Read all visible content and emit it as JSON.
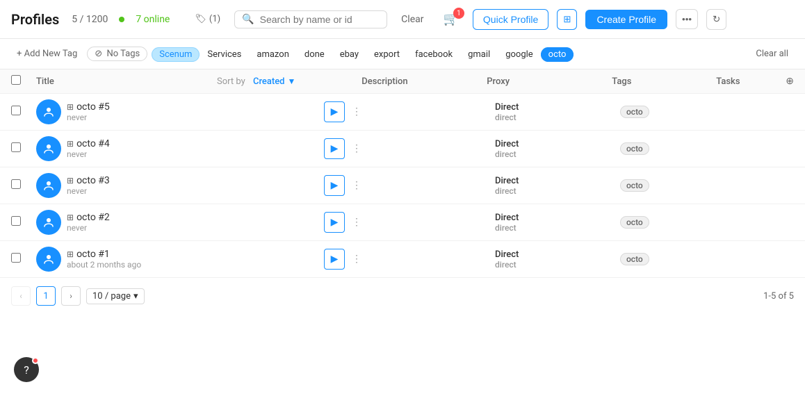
{
  "header": {
    "title": "Profiles",
    "count": "5 / 1200",
    "online_count": "7 online",
    "tag_label": "(1)",
    "search_placeholder": "Search by name or id",
    "clear_label": "Clear",
    "cart_badge": "1",
    "quick_profile_label": "Quick Profile",
    "create_profile_label": "Create Profile"
  },
  "tags_bar": {
    "add_tag_label": "+ Add New Tag",
    "no_tags_label": "No Tags",
    "tags": [
      {
        "id": "scenum",
        "label": "Scenum",
        "active": false,
        "blue": true
      },
      {
        "id": "services",
        "label": "Services",
        "active": false,
        "blue": false
      },
      {
        "id": "amazon",
        "label": "amazon",
        "active": false,
        "blue": false
      },
      {
        "id": "done",
        "label": "done",
        "active": false,
        "blue": false
      },
      {
        "id": "ebay",
        "label": "ebay",
        "active": false,
        "blue": false
      },
      {
        "id": "export",
        "label": "export",
        "active": false,
        "blue": false
      },
      {
        "id": "facebook",
        "label": "facebook",
        "active": false,
        "blue": false
      },
      {
        "id": "gmail",
        "label": "gmail",
        "active": false,
        "blue": false
      },
      {
        "id": "google",
        "label": "google",
        "active": false,
        "blue": false
      },
      {
        "id": "octo",
        "label": "octo",
        "active": true,
        "blue": false
      }
    ],
    "clear_all_label": "Clear all"
  },
  "table": {
    "col_title": "Title",
    "col_sort_by": "Sort by",
    "col_sort_field": "Created",
    "col_desc": "Description",
    "col_proxy": "Proxy",
    "col_tags": "Tags",
    "col_tasks": "Tasks",
    "rows": [
      {
        "id": 5,
        "name": "octo #5",
        "sub": "never",
        "proxy_main": "Direct",
        "proxy_sub": "direct",
        "tag": "octo"
      },
      {
        "id": 4,
        "name": "octo #4",
        "sub": "never",
        "proxy_main": "Direct",
        "proxy_sub": "direct",
        "tag": "octo"
      },
      {
        "id": 3,
        "name": "octo #3",
        "sub": "never",
        "proxy_main": "Direct",
        "proxy_sub": "direct",
        "tag": "octo"
      },
      {
        "id": 2,
        "name": "octo #2",
        "sub": "never",
        "proxy_main": "Direct",
        "proxy_sub": "direct",
        "tag": "octo"
      },
      {
        "id": 1,
        "name": "octo #1",
        "sub": "about 2 months ago",
        "proxy_main": "Direct",
        "proxy_sub": "direct",
        "tag": "octo"
      }
    ]
  },
  "pagination": {
    "current_page": "1",
    "page_size": "10 / page",
    "range_label": "1-5 of 5"
  },
  "help": {
    "icon": "?"
  }
}
